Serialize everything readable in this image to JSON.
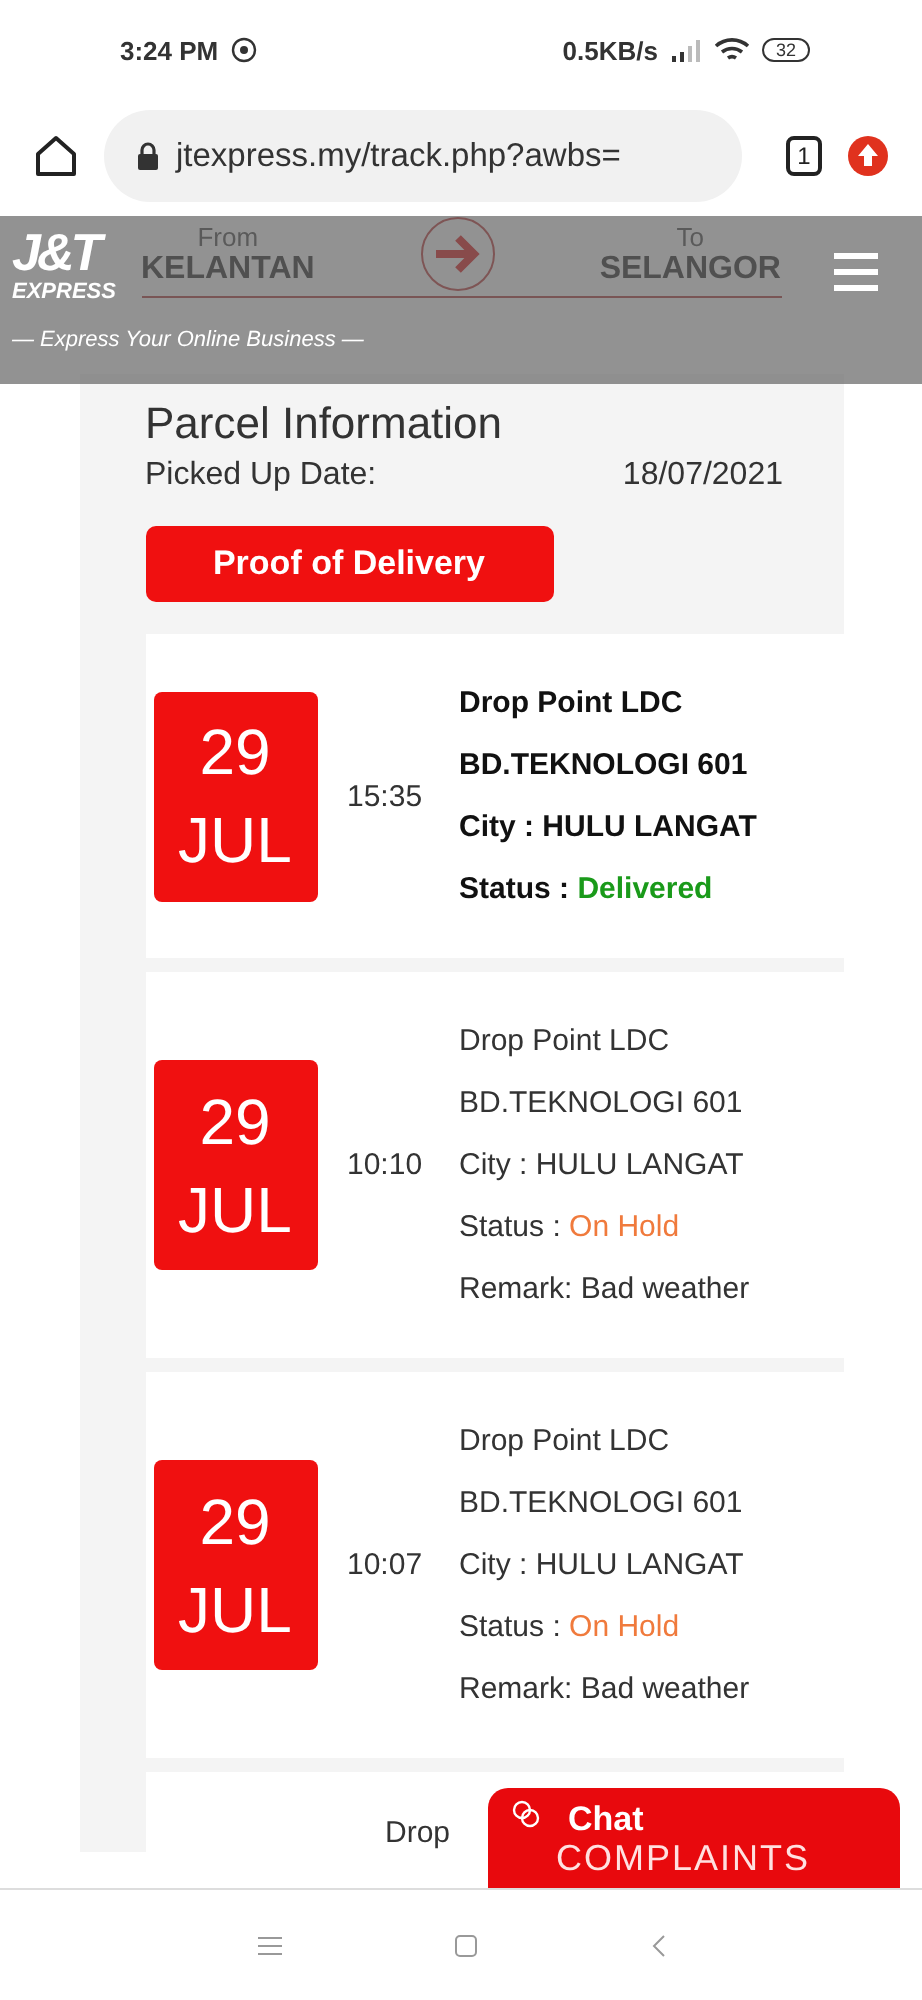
{
  "status_bar": {
    "time": "3:24 PM",
    "speed": "0.5KB/s",
    "battery": "32"
  },
  "browser": {
    "url": "jtexpress.my/track.php?awbs=",
    "tab_count": "1"
  },
  "header": {
    "logo": "J&T",
    "logo_sub": "EXPRESS",
    "tagline": "— Express Your Online Business —"
  },
  "route": {
    "from_label": "From",
    "from": "KELANTAN",
    "to_label": "To",
    "to": "SELANGOR"
  },
  "parcel": {
    "title": "Parcel Information",
    "picked_label": "Picked Up Date:",
    "picked_date": "18/07/2021",
    "proof_button": "Proof of Delivery"
  },
  "events": [
    {
      "day": "29",
      "month": "JUL",
      "time": "15:35",
      "latest": true,
      "place": "Drop Point LDC",
      "branch": "BD.TEKNOLOGI 601",
      "city": "City : HULU LANGAT",
      "status_label": "Status : ",
      "status": "Delivered",
      "color": "#1a9a1a"
    },
    {
      "day": "29",
      "month": "JUL",
      "time": "10:10",
      "latest": false,
      "place": "Drop Point LDC",
      "branch": "BD.TEKNOLOGI 601",
      "city": "City : HULU LANGAT",
      "status_label": "Status : ",
      "status": "On Hold",
      "color": "#f07a3c",
      "remark": "Remark: Bad weather"
    },
    {
      "day": "29",
      "month": "JUL",
      "time": "10:07",
      "latest": false,
      "place": "Drop Point LDC",
      "branch": "BD.TEKNOLOGI 601",
      "city": "City : HULU LANGAT",
      "status_label": "Status : ",
      "status": "On Hold",
      "color": "#f07a3c",
      "remark": "Remark: Bad weather"
    }
  ],
  "partial_event": {
    "place": "Drop"
  },
  "chat": {
    "label": "Chat",
    "sub": "COMPLAINTS"
  }
}
